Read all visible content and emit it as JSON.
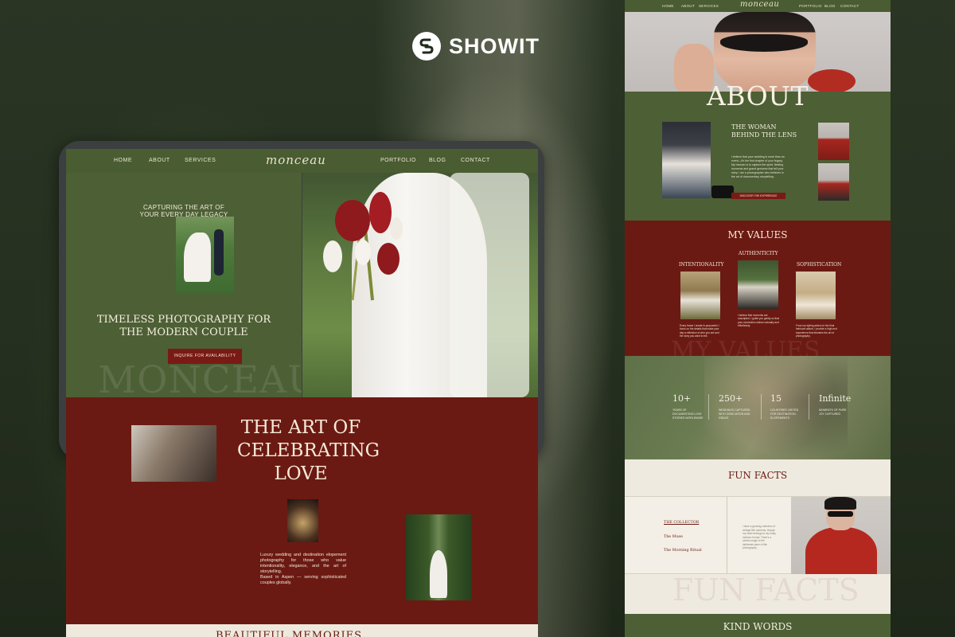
{
  "brand": {
    "name": "SHOWIT"
  },
  "left_page": {
    "nav": {
      "home": "HOME",
      "about": "ABOUT",
      "services": "SERVICES",
      "logo": "monceau",
      "portfolio": "PORTFOLIO",
      "blog": "BLOG",
      "contact": "CONTACT"
    },
    "hero": {
      "tagline_line1": "CAPTURING THE ART OF",
      "tagline_line2": "YOUR EVERY DAY LEGACY",
      "title_line1": "TIMELESS PHOTOGRAPHY FOR",
      "title_line2": "THE MODERN COUPLE",
      "cta": "INQUIRE FOR AVAILABILITY",
      "watermark": "MONCEAU"
    },
    "love": {
      "title_line1": "THE ART OF",
      "title_line2": "CELEBRATING",
      "title_line3": "LOVE",
      "copy": "Luxury wedding and destination elopement photography for those who value intentionality, elegance, and the art of storytelling.",
      "copy2": "Based in Aspen — serving sophisticated couples globally."
    },
    "memories": {
      "title": "BEAUTIFUL MEMORIES"
    }
  },
  "right_page": {
    "nav": {
      "home": "HOME",
      "about": "ABOUT",
      "services": "SERVICES",
      "logo": "monceau",
      "portfolio": "PORTFOLIO",
      "blog": "BLOG",
      "contact": "CONTACT"
    },
    "about": {
      "title": "ABOUT",
      "heading_line1": "THE WOMAN",
      "heading_line2": "BEHIND THE LENS",
      "copy": "I believe that your wedding is more than an event—it's the first chapter of your legacy. My mission is to capture the quiet, fleeting moments and grand gestures that tell your story. I am a photographer who believes in the art of documentary storytelling.",
      "cta": "DISCOVER THE EXPERIENCE"
    },
    "values": {
      "title": "MY VALUES",
      "items": [
        {
          "label": "INTENTIONALITY",
          "copy": "Every frame I create is purposeful. I focus on the details that make your day a reflection of who you are and the story you want to tell."
        },
        {
          "label": "AUTHENTICITY",
          "copy": "I believe that moments are unscripted. I guide you gently so that your connection shines naturally and effortlessly."
        },
        {
          "label": "SOPHISTICATION",
          "copy": "From my styling advice to the final heirloom album, I provide a high-end experience that elevates the art of photography."
        }
      ],
      "watermark": "MY VALUES"
    },
    "stats": [
      {
        "num": "10+",
        "label": "YEARS OF DOCUMENTING LOVE STORIES WORLDWIDE"
      },
      {
        "num": "250+",
        "label": "WEDDINGS CAPTURED WITH DEDICATION AND GRACE"
      },
      {
        "num": "15",
        "label": "COUNTRIES VISITED FOR DESTINATION ELOPEMENTS"
      },
      {
        "num": "Infinite",
        "label": "MOMENTS OF PURE JOY CAPTURED"
      }
    ],
    "fun_facts": {
      "title": "FUN FACTS",
      "items": [
        "THE COLLECTOR",
        "The Muse",
        "The Morning Ritual"
      ],
      "copy": "I have a growing collection of vintage film cameras, though my heart belongs to my trusty medium format. There's a certain magic to the deliberate pace of film photography.",
      "watermark": "FUN FACTS"
    },
    "kind_words": {
      "title": "KIND WORDS"
    }
  },
  "colors": {
    "olive": "#4d5f35",
    "burgundy": "#6b1a13",
    "cream": "#efeadf",
    "button": "#7a1a14"
  }
}
